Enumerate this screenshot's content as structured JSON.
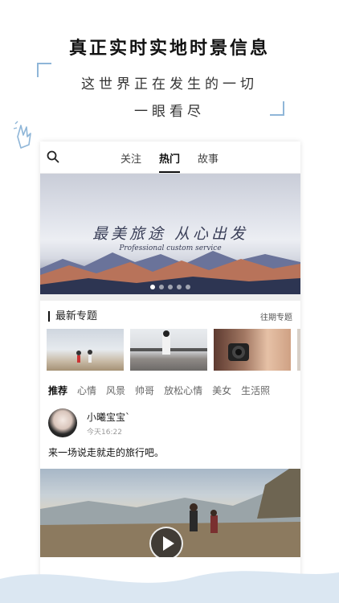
{
  "promo": {
    "title": "真正实时实地时景信息",
    "line1": "这世界正在发生的一切",
    "line2": "一眼看尽"
  },
  "nav": {
    "tabs": [
      "关注",
      "热门",
      "故事"
    ],
    "active_tab": "热门"
  },
  "banner": {
    "title": "最美旅途 从心出发",
    "subtitle": "Professional custom service",
    "slides": 5,
    "active_slide": 1
  },
  "topics": {
    "title": "最新专题",
    "more_label": "往期专题"
  },
  "categories": [
    "推荐",
    "心情",
    "风景",
    "帅哥",
    "放松心情",
    "美女",
    "生活照"
  ],
  "active_category": "推荐",
  "post": {
    "author": "小曦宝宝`",
    "time": "今天16:22",
    "text": "来一场说走就走的旅行吧。"
  },
  "colors": {
    "accent_bracket": "#8fb6d8",
    "wave": "#dbe7f2"
  }
}
